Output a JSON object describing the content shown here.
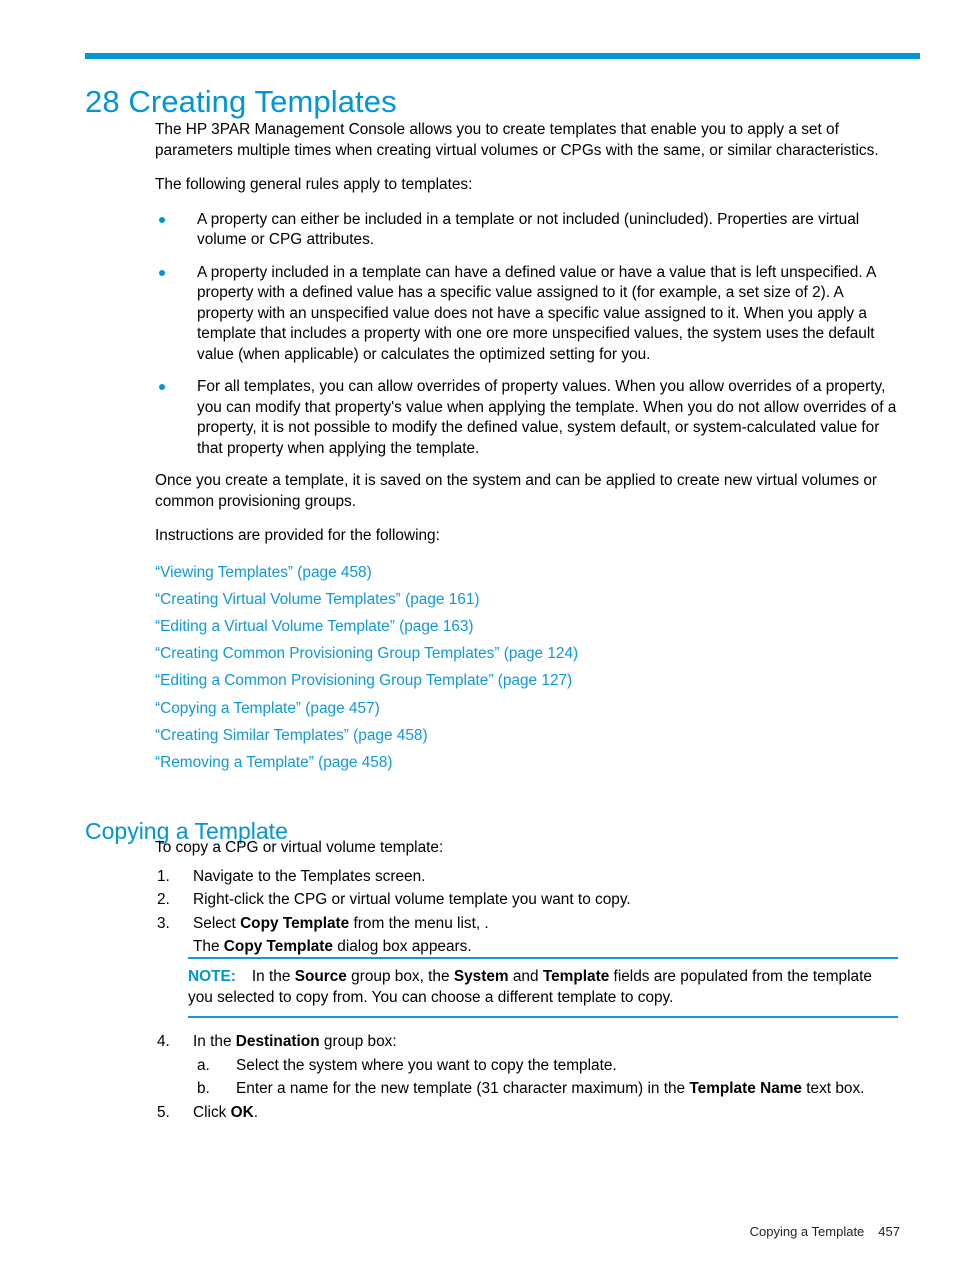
{
  "chapter": {
    "number": "28",
    "title": "28 Creating Templates"
  },
  "intro": {
    "paragraph1": "The HP 3PAR Management Console allows you to create templates that enable you to apply a set of parameters multiple times when creating virtual volumes or CPGs with the same, or similar characteristics.",
    "paragraph2": "The following general rules apply to templates:"
  },
  "rules": [
    "A property can either be included in a template or not included (unincluded). Properties are virtual volume or CPG attributes.",
    "A property included in a template can have a defined value or have a value that is left unspecified. A property with a defined value has a specific value assigned to it (for example, a set size of 2). A property with an unspecified value does not have a specific value assigned to it. When you apply a template that includes a property with one ore more unspecified values, the system uses the default value (when applicable) or calculates the optimized setting for you.",
    "For all templates, you can allow overrides of property values. When you allow overrides of a property, you can modify that property's value when applying the template. When you do not allow overrides of a property, it is not possible to modify the defined value, system default, or system-calculated value for that property when applying the template."
  ],
  "afterRules": {
    "paragraph1": "Once you create a template, it is saved on the system and can be applied to create new virtual volumes or common provisioning groups.",
    "paragraph2": "Instructions are provided for the following:"
  },
  "crossReferences": [
    "“Viewing Templates” (page 458)",
    "“Creating Virtual Volume Templates” (page 161)",
    "“Editing a Virtual Volume Template” (page 163)",
    "“Creating Common Provisioning Group Templates” (page 124)",
    "“Editing a Common Provisioning Group Template” (page 127)",
    "“Copying a Template” (page 457)",
    "“Creating Similar Templates” (page 458)",
    "“Removing a Template” (page 458)"
  ],
  "section": {
    "heading": "Copying a Template",
    "lead": "To copy a CPG or virtual volume template:"
  },
  "steps": [
    {
      "marker": "1.",
      "text_plain": "Navigate to the Templates screen."
    },
    {
      "marker": "2.",
      "text_plain": "Right-click the CPG or virtual volume template you want to copy."
    },
    {
      "marker": "3.",
      "text_pre": "Select ",
      "text_bold": "Copy Template",
      "text_post": " from the menu list, ."
    },
    {
      "marker": "4.",
      "text_pre": "In the ",
      "text_bold": "Destination",
      "text_post": " group box:"
    },
    {
      "marker": "5.",
      "text_pre": "Click ",
      "text_bold": "OK",
      "text_post": "."
    }
  ],
  "step3_follow": {
    "pre": "The ",
    "bold": "Copy Template",
    "post": " dialog box appears."
  },
  "substeps": [
    {
      "marker": "a.",
      "text_plain": "Select the system where you want to copy the template."
    },
    {
      "marker": "b.",
      "text_pre": "Enter a name for the new template (31 character maximum) in the ",
      "text_bold": "Template Name",
      "text_post": " text box."
    }
  ],
  "note": {
    "label": "NOTE:",
    "seg1": "In the ",
    "bold1": "Source",
    "seg2": " group box, the ",
    "bold2": "System",
    "seg3": " and ",
    "bold3": "Template",
    "seg4": " fields are populated from the template you selected to copy from. You can choose a different template to copy."
  },
  "footer": {
    "title": "Copying a Template",
    "page": "457"
  },
  "colors": {
    "accent": "#0096d6",
    "link": "#0e9ada",
    "text": "#000000"
  }
}
